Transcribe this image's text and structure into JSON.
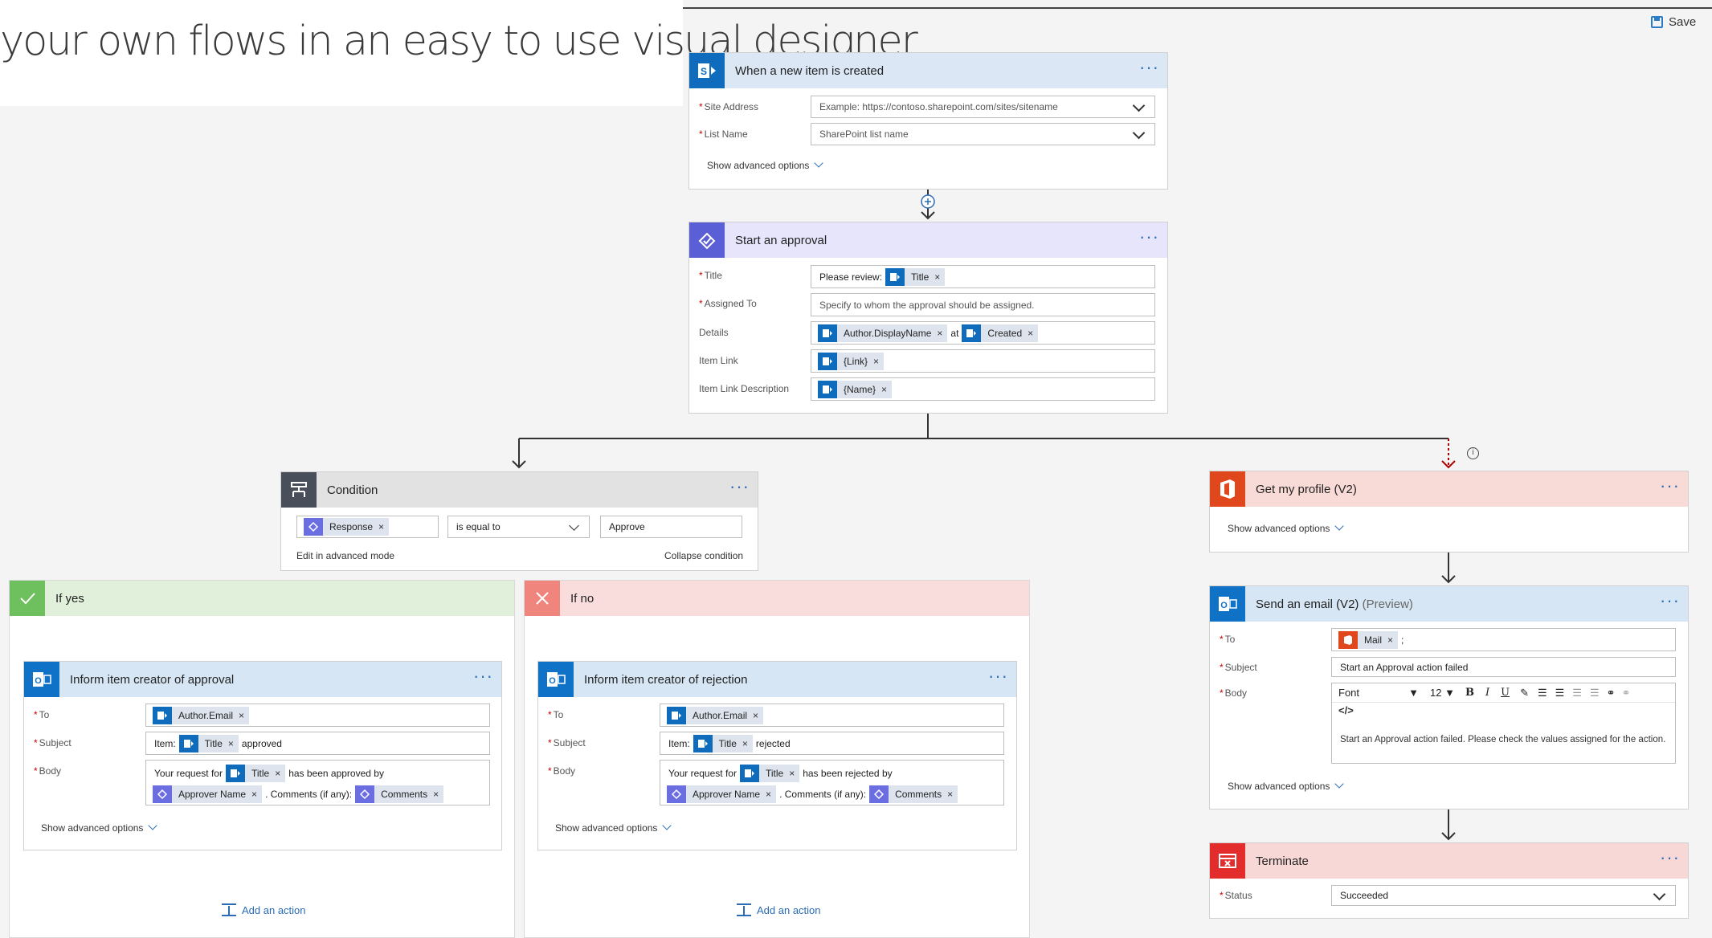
{
  "banner": {
    "headline": "your own flows in an easy to use visual designer"
  },
  "toolbar": {
    "save_label": "Save"
  },
  "trigger": {
    "title": "When a new item is created",
    "site_label": "Site Address",
    "site_placeholder": "Example: https://contoso.sharepoint.com/sites/sitename",
    "list_label": "List Name",
    "list_placeholder": "SharePoint list name",
    "advanced": "Show advanced options"
  },
  "approval": {
    "title": "Start an approval",
    "title_label": "Title",
    "title_prefix": "Please review:",
    "title_token": "Title",
    "assigned_label": "Assigned To",
    "assigned_placeholder": "Specify to whom the approval should be assigned.",
    "details_label": "Details",
    "details_token1": "Author.DisplayName",
    "details_mid": "at",
    "details_token2": "Created",
    "link_label": "Item Link",
    "link_token": "{Link}",
    "linkdesc_label": "Item Link Description",
    "linkdesc_token": "{Name}"
  },
  "condition": {
    "title": "Condition",
    "left_token": "Response",
    "operator": "is equal to",
    "value": "Approve",
    "advanced_mode": "Edit in advanced mode",
    "collapse": "Collapse condition"
  },
  "if_yes": {
    "label": "If yes",
    "card_title": "Inform item creator of approval",
    "to_label": "To",
    "to_token": "Author.Email",
    "subject_label": "Subject",
    "subject_prefix": "Item:",
    "subject_token": "Title",
    "subject_suffix": "approved",
    "body_label": "Body",
    "body_text1": "Your request for",
    "body_token1": "Title",
    "body_text2": "has been approved by",
    "body_token2": "Approver Name",
    "body_text3": ". Comments (if any):",
    "body_token3": "Comments",
    "advanced": "Show advanced options",
    "add_action": "Add an action"
  },
  "if_no": {
    "label": "If no",
    "card_title": "Inform item creator of rejection",
    "to_label": "To",
    "to_token": "Author.Email",
    "subject_label": "Subject",
    "subject_prefix": "Item:",
    "subject_token": "Title",
    "subject_suffix": "rejected",
    "body_label": "Body",
    "body_text1": "Your request for",
    "body_token1": "Title",
    "body_text2": "has been rejected by",
    "body_token2": "Approver Name",
    "body_text3": ". Comments (if any):",
    "body_token3": "Comments",
    "advanced": "Show advanced options",
    "add_action": "Add an action"
  },
  "profile": {
    "title": "Get my profile (V2)",
    "advanced": "Show advanced options"
  },
  "email": {
    "title": "Send an email (V2)",
    "title_suffix": "(Preview)",
    "to_label": "To",
    "to_token": "Mail",
    "to_suffix": ";",
    "subject_label": "Subject",
    "subject_value": "Start an Approval action failed",
    "body_label": "Body",
    "font": "Font",
    "size": "12",
    "code": "</>",
    "body_value": "Start an Approval action failed. Please check the values assigned for the action.",
    "advanced": "Show advanced options"
  },
  "terminate": {
    "title": "Terminate",
    "status_label": "Status",
    "status_value": "Succeeded"
  },
  "colors": {
    "sharepoint": "#0f6cbd",
    "approvals": "#5b5fd6",
    "office": "#e0471c",
    "terminate": "#e32c2c",
    "link": "#2b6cb5"
  }
}
